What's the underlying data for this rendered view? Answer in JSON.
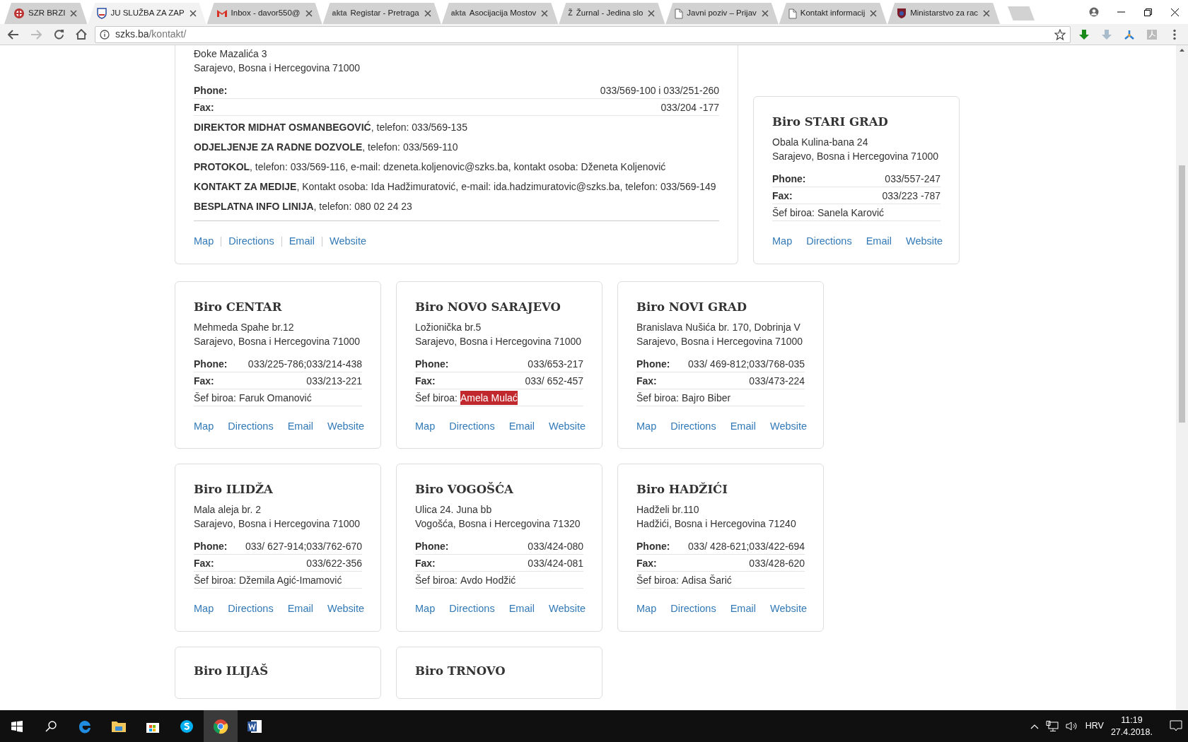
{
  "browser": {
    "tabs": [
      {
        "title": "SZR BRZI",
        "selected": false
      },
      {
        "title": "JU SLUŽBA ZA ZAP",
        "selected": true
      },
      {
        "title": "Inbox - davor550@",
        "selected": false
      },
      {
        "title": "Registar - Pretraga",
        "glyph": "akta",
        "selected": false
      },
      {
        "title": "Asocijacija Mostov",
        "glyph": "akta",
        "selected": false
      },
      {
        "title": "Žurnal - Jedina slo",
        "glyph": "Ž",
        "selected": false
      },
      {
        "title": "Javni poziv – Prijav",
        "selected": false
      },
      {
        "title": "Kontakt informacij",
        "selected": false
      },
      {
        "title": "Ministarstvo za rac",
        "selected": false
      }
    ],
    "address": {
      "host": "szks.ba",
      "path": "/kontakt/"
    }
  },
  "main_office": {
    "address_lines": [
      "Đoke Mazalića 3",
      "Sarajevo, Bosna i Hercegovina 71000"
    ],
    "phone_label": "Phone:",
    "phone": "033/569-100 i 033/251-260",
    "fax_label": "Fax:",
    "fax": "033/204 -177",
    "notes": [
      "**DIREKTOR MIDHAT OSMANBEGOVIĆ**, telefon: 033/569-135",
      "**ODJELJENJE ZA RADNE DOZVOLE**, telefon: 033/569-110",
      "**PROTOKOL**, telefon: 033/569-116, e-mail: dzeneta.koljenovic@szks.ba, kontakt osoba: Dženeta Koljenović",
      "**KONTAKT ZA MEDIJE**, Kontakt osoba: Ida Hadžimuratović, e-mail: ida.hadzimuratovic@szks.ba, telefon: 033/569-149",
      "**BESPLATNA INFO LINIJA**, telefon: 080 02 24 23"
    ],
    "links": [
      "Map",
      "Directions",
      "Email",
      "Website"
    ]
  },
  "offices": [
    {
      "title": "Biro STARI GRAD",
      "address_lines": [
        "Obala Kulina-bana 24",
        "Sarajevo, Bosna i Hercegovina 71000"
      ],
      "phone_label": "Phone:",
      "phone": "033/557-247",
      "fax_label": "Fax:",
      "fax": "033/223 -787",
      "manager_label": "Šef biroa:",
      "manager": "Sanela Karović",
      "highlighted": false,
      "links": [
        "Map",
        "Directions",
        "Email",
        "Website"
      ]
    },
    {
      "title": "Biro CENTAR",
      "address_lines": [
        "Mehmeda Spahe br.12",
        "Sarajevo, Bosna i Hercegovina 71000"
      ],
      "phone_label": "Phone:",
      "phone": "033/225-786;033/214-438",
      "fax_label": "Fax:",
      "fax": "033/213-221",
      "manager_label": "Šef biroa:",
      "manager": "Faruk Omanović",
      "highlighted": false,
      "links": [
        "Map",
        "Directions",
        "Email",
        "Website"
      ]
    },
    {
      "title": "Biro NOVO SARAJEVO",
      "address_lines": [
        "Ložionička br.5",
        "Sarajevo, Bosna i Hercegovina 71000"
      ],
      "phone_label": "Phone:",
      "phone": "033/653-217",
      "fax_label": "Fax:",
      "fax": "033/ 652-457",
      "manager_label": "Šef biroa:",
      "manager": "Amela Mulać",
      "highlighted": true,
      "links": [
        "Map",
        "Directions",
        "Email",
        "Website"
      ]
    },
    {
      "title": "Biro NOVI GRAD",
      "address_lines": [
        "Branislava Nušića br. 170, Dobrinja V",
        "Sarajevo, Bosna i Hercegovina 71000"
      ],
      "phone_label": "Phone:",
      "phone": "033/ 469-812;033/768-035",
      "fax_label": "Fax:",
      "fax": "033/473-224",
      "manager_label": "Šef biroa:",
      "manager": "Bajro Biber",
      "highlighted": false,
      "links": [
        "Map",
        "Directions",
        "Email",
        "Website"
      ]
    },
    {
      "title": "Biro ILIDŽA",
      "address_lines": [
        "Mala aleja br. 2",
        "Sarajevo, Bosna i Hercegovina 71000"
      ],
      "phone_label": "Phone:",
      "phone": "033/ 627-914;033/762-670",
      "fax_label": "Fax:",
      "fax": "033/622-356",
      "manager_label": "Šef biroa:",
      "manager": "Džemila Agić-Imamović",
      "highlighted": false,
      "links": [
        "Map",
        "Directions",
        "Email",
        "Website"
      ]
    },
    {
      "title": "Biro VOGOŠĆA",
      "address_lines": [
        "Ulica 24. Juna bb",
        "Vogošća, Bosna i Hercegovina 71320"
      ],
      "phone_label": "Phone:",
      "phone": "033/424-080",
      "fax_label": "Fax:",
      "fax": "033/424-081",
      "manager_label": "Šef biroa:",
      "manager": "Avdo Hodžić",
      "highlighted": false,
      "links": [
        "Map",
        "Directions",
        "Email",
        "Website"
      ]
    },
    {
      "title": "Biro HADŽIĆI",
      "address_lines": [
        "Hadželi br.110",
        "Hadžići, Bosna i Hercegovina 71240"
      ],
      "phone_label": "Phone:",
      "phone": "033/ 428-621;033/422-694",
      "fax_label": "Fax:",
      "fax": "033/428-620",
      "manager_label": "Šef biroa:",
      "manager": "Adisa Šarić",
      "highlighted": false,
      "links": [
        "Map",
        "Directions",
        "Email",
        "Website"
      ]
    },
    {
      "title": "Biro ILIJAŠ"
    },
    {
      "title": "Biro TRNOVO"
    }
  ],
  "taskbar": {
    "language": "HRV",
    "time": "11:19",
    "date": "27.4.2018."
  }
}
